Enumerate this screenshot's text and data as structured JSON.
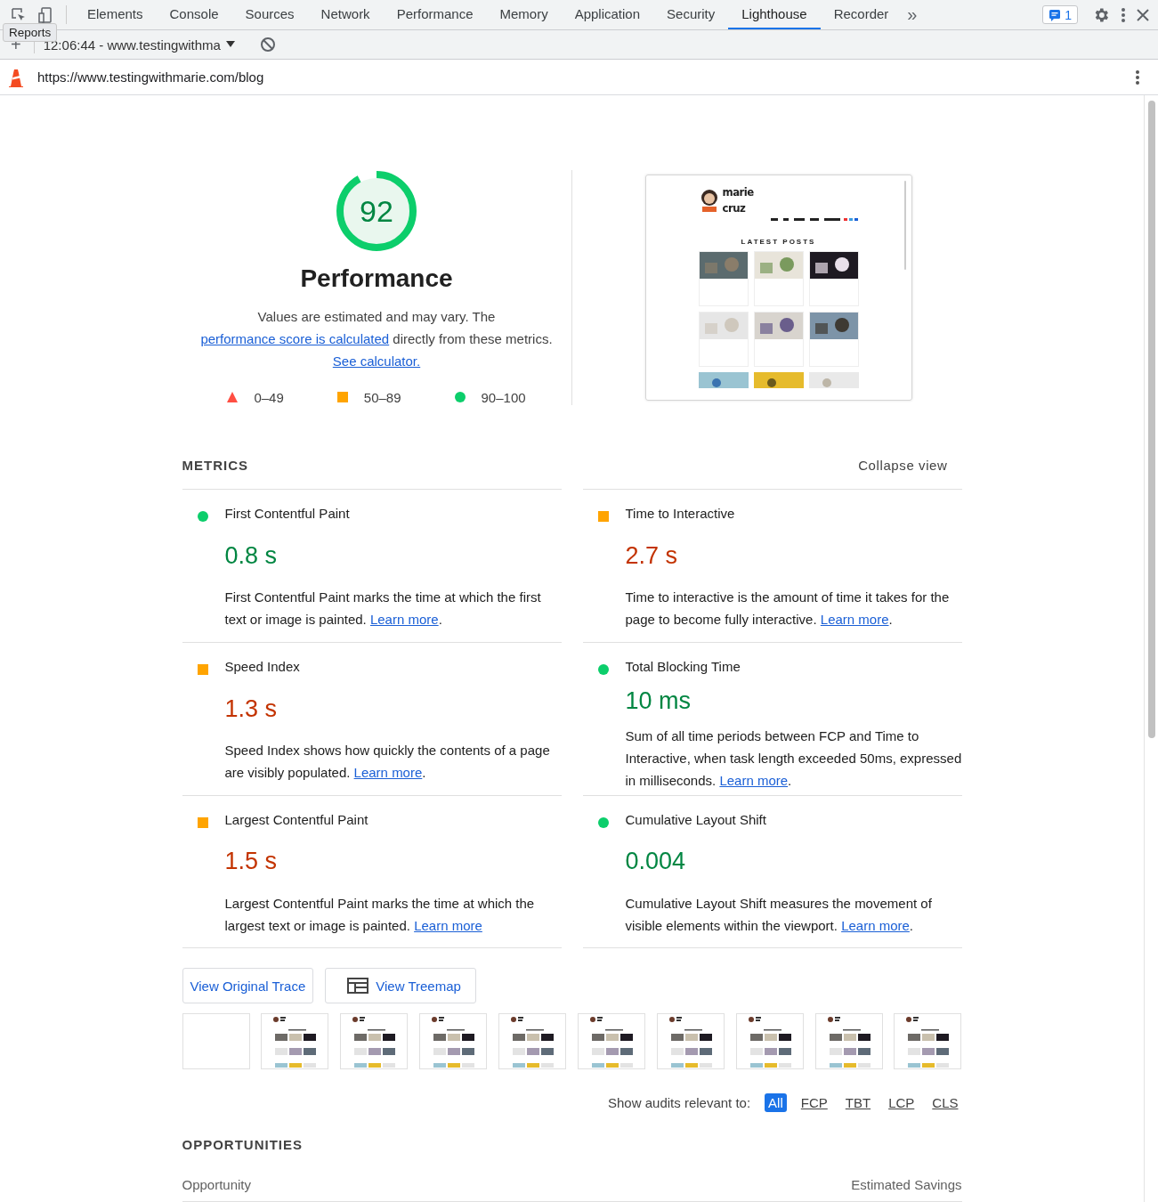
{
  "devtools": {
    "tabs": [
      {
        "label": "Elements",
        "selected": false
      },
      {
        "label": "Console",
        "selected": false
      },
      {
        "label": "Sources",
        "selected": false
      },
      {
        "label": "Network",
        "selected": false
      },
      {
        "label": "Performance",
        "selected": false
      },
      {
        "label": "Memory",
        "selected": false
      },
      {
        "label": "Application",
        "selected": false
      },
      {
        "label": "Security",
        "selected": false
      },
      {
        "label": "Lighthouse",
        "selected": true
      },
      {
        "label": "Recorder",
        "selected": false
      }
    ],
    "more": "»",
    "issues_count": "1",
    "tooltip": "Reports",
    "report_select": "12:06:44 - www.testingwithma",
    "add": "+"
  },
  "url": "https://www.testingwithmarie.com/blog",
  "score": {
    "value": "92",
    "level": 0.92,
    "title": "Performance",
    "description": [
      {
        "kind": "text",
        "text": "Values are estimated and may vary. The "
      },
      {
        "kind": "link",
        "text": "performance score is calculated"
      },
      {
        "kind": "text",
        "text": " directly from these metrics. "
      },
      {
        "kind": "link",
        "text": "See calculator."
      }
    ],
    "legend": [
      {
        "kind": "fail",
        "label": "0–49"
      },
      {
        "kind": "average",
        "label": "50–89"
      },
      {
        "kind": "pass",
        "label": "90–100"
      }
    ]
  },
  "preview": {
    "name_line_1": "marie",
    "name_line_2": "cruz",
    "heading": "LATEST POSTS"
  },
  "metrics_title": "METRICS",
  "collapse": "Collapse view",
  "metrics": [
    {
      "kind": "pass",
      "name": "First Contentful Paint",
      "value": "0.8 s",
      "description": "First Contentful Paint marks the time at which the first text or image is painted.",
      "link": "Learn more",
      "after": "."
    },
    {
      "kind": "average",
      "name": "Time to Interactive",
      "value": "2.7 s",
      "description": "Time to interactive is the amount of time it takes for the page to become fully interactive.",
      "link": "Learn more",
      "after": "."
    },
    {
      "kind": "average",
      "name": "Speed Index",
      "value": "1.3 s",
      "description": "Speed Index shows how quickly the contents of a page are visibly populated.",
      "link": "Learn more",
      "after": "."
    },
    {
      "kind": "pass",
      "name": "Total Blocking Time",
      "value": "10 ms",
      "description": "Sum of all time periods between FCP and Time to Interactive, when task length exceeded 50ms, expressed in milliseconds.",
      "link": "Learn more",
      "after": "."
    },
    {
      "kind": "average",
      "name": "Largest Contentful Paint",
      "value": "1.5 s",
      "description": "Largest Contentful Paint marks the time at which the largest text or image is painted.",
      "link": "Learn more"
    },
    {
      "kind": "pass",
      "name": "Cumulative Layout Shift",
      "value": "0.004",
      "description": "Cumulative Layout Shift measures the movement of visible elements within the viewport.",
      "link": "Learn more",
      "after": "."
    }
  ],
  "buttons": [
    {
      "kind": "plain",
      "label": "View Original Trace"
    },
    {
      "kind": "treemap",
      "label": "View Treemap"
    }
  ],
  "filmstrip": [
    {
      "kind": "blank"
    },
    {
      "kind": "page"
    },
    {
      "kind": "page"
    },
    {
      "kind": "page"
    },
    {
      "kind": "page"
    },
    {
      "kind": "page"
    },
    {
      "kind": "page"
    },
    {
      "kind": "page"
    },
    {
      "kind": "page"
    },
    {
      "kind": "page"
    }
  ],
  "filter": {
    "label": "Show audits relevant to:",
    "chips": [
      {
        "label": "All",
        "selected": true
      },
      {
        "label": "FCP",
        "selected": false
      },
      {
        "label": "TBT",
        "selected": false
      },
      {
        "label": "LCP",
        "selected": false
      },
      {
        "label": "CLS",
        "selected": false
      }
    ]
  },
  "opportunities": {
    "title": "OPPORTUNITIES",
    "column_1": "Opportunity",
    "column_2": "Estimated Savings"
  }
}
